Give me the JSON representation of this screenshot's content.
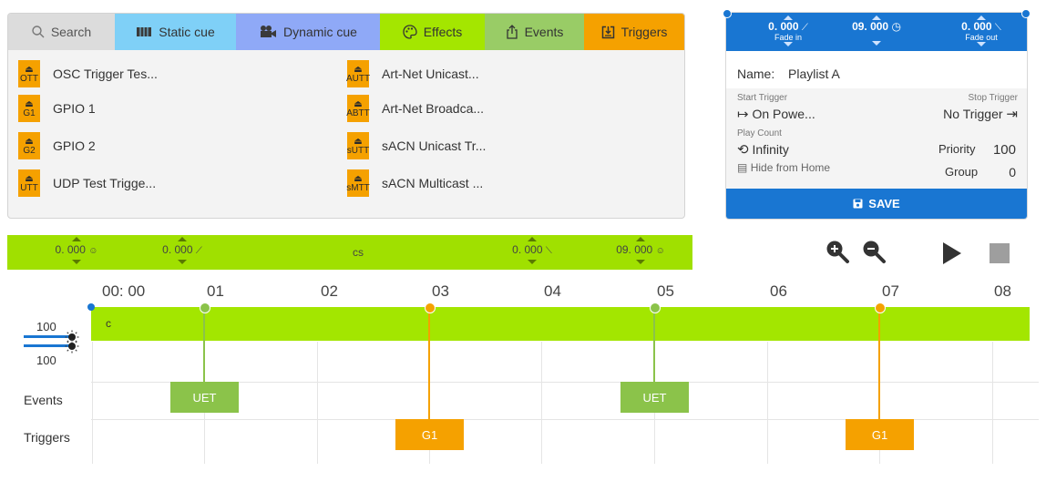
{
  "tabs": [
    {
      "label": "Search",
      "icon": "search-icon",
      "color": "#dcdcdc"
    },
    {
      "label": "Static cue",
      "icon": "static-cue-icon",
      "color": "#7fd0f7"
    },
    {
      "label": "Dynamic cue",
      "icon": "dynamic-cue-icon",
      "color": "#8fa9f7"
    },
    {
      "label": "Effects",
      "icon": "palette-icon",
      "color": "#a4e600"
    },
    {
      "label": "Events",
      "icon": "share-icon",
      "color": "#99cc66"
    },
    {
      "label": "Triggers",
      "icon": "trigger-icon",
      "color": "#f5a100"
    }
  ],
  "triggers": [
    {
      "badge": "OTT",
      "label": "OSC Trigger Tes..."
    },
    {
      "badge": "G1",
      "label": "GPIO 1"
    },
    {
      "badge": "G2",
      "label": "GPIO 2"
    },
    {
      "badge": "UTT",
      "label": "UDP Test Trigge..."
    },
    {
      "badge": "AUTT",
      "label": "Art-Net Unicast..."
    },
    {
      "badge": "ABTT",
      "label": "Art-Net Broadca..."
    },
    {
      "badge": "sUTT",
      "label": "sACN Unicast Tr..."
    },
    {
      "badge": "sMTT",
      "label": "sACN Multicast ..."
    }
  ],
  "playlist": {
    "fade_in_value": "0. 000",
    "fade_in_label": "Fade in",
    "duration_value": "09. 000",
    "fade_out_value": "0. 000",
    "fade_out_label": "Fade out",
    "name_label": "Name:",
    "name_value": "Playlist A",
    "start_trigger_label": "Start Trigger",
    "start_trigger_value": "On Powe...",
    "stop_trigger_label": "Stop Trigger",
    "stop_trigger_value": "No Trigger",
    "play_count_label": "Play Count",
    "play_count_value": "Infinity",
    "priority_label": "Priority",
    "priority_value": "100",
    "hide_label": "Hide from Home",
    "group_label": "Group",
    "group_value": "0",
    "save_label": "SAVE"
  },
  "timeline_bar": {
    "field1": "0. 000",
    "field2": "0. 000",
    "name": "cs",
    "field3": "0. 000",
    "field4": "09. 000"
  },
  "timeline": {
    "ticks": [
      "00: 00",
      "01",
      "02",
      "03",
      "04",
      "05",
      "06",
      "07",
      "08"
    ],
    "cue_label": "c",
    "slider1_value": "100",
    "slider2_value": "100",
    "events_label": "Events",
    "triggers_label": "Triggers",
    "events": [
      {
        "label": "UET",
        "time": 1
      },
      {
        "label": "UET",
        "time": 5
      }
    ],
    "trigger_blocks": [
      {
        "label": "G1",
        "time": 3
      },
      {
        "label": "G1",
        "time": 7
      }
    ]
  },
  "colors": {
    "accent": "#1976d2",
    "cue": "#a3e600",
    "event": "#8bc34a",
    "trigger": "#f5a100"
  }
}
